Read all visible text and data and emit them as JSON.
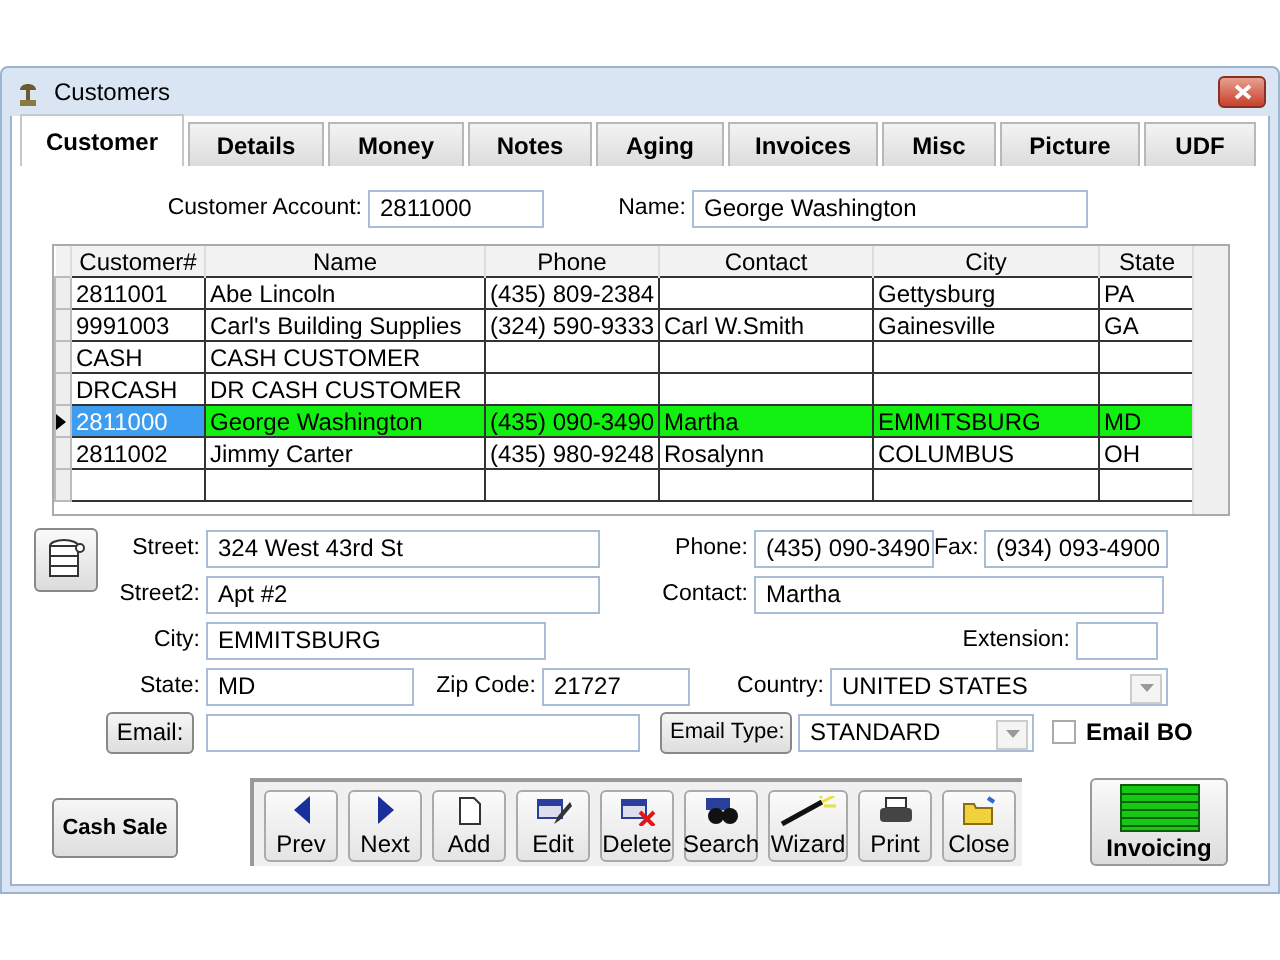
{
  "window": {
    "title": "Customers"
  },
  "tabs": [
    {
      "label": "Customer",
      "selected": true
    },
    {
      "label": "Details",
      "selected": false
    },
    {
      "label": "Money",
      "selected": false
    },
    {
      "label": "Notes",
      "selected": false
    },
    {
      "label": "Aging",
      "selected": false
    },
    {
      "label": "Invoices",
      "selected": false
    },
    {
      "label": "Misc",
      "selected": false
    },
    {
      "label": "Picture",
      "selected": false
    },
    {
      "label": "UDF",
      "selected": false
    }
  ],
  "account": {
    "label": "Customer Account:",
    "value": "2811000"
  },
  "name": {
    "label": "Name:",
    "value": "George Washington"
  },
  "table": {
    "columns": [
      "Customer#",
      "Name",
      "Phone",
      "Contact",
      "City",
      "State"
    ],
    "rows": [
      {
        "cells": [
          "2811001",
          "Abe Lincoln",
          "(435) 809-2384",
          "",
          "Gettysburg",
          "PA"
        ],
        "selected": false
      },
      {
        "cells": [
          "9991003",
          "Carl's Building Supplies",
          "(324) 590-9333",
          "Carl W.Smith",
          "Gainesville",
          "GA"
        ],
        "selected": false
      },
      {
        "cells": [
          "CASH",
          "CASH CUSTOMER",
          "",
          "",
          "",
          ""
        ],
        "selected": false
      },
      {
        "cells": [
          "DRCASH",
          "DR CASH CUSTOMER",
          "",
          "",
          "",
          ""
        ],
        "selected": false
      },
      {
        "cells": [
          "2811000",
          "George Washington",
          "(435) 090-3490",
          "Martha",
          "EMMITSBURG",
          "MD"
        ],
        "selected": true
      },
      {
        "cells": [
          "2811002",
          "Jimmy Carter",
          "(435) 980-9248",
          "Rosalynn",
          "COLUMBUS",
          "OH"
        ],
        "selected": false
      }
    ]
  },
  "street": {
    "label": "Street:",
    "value": "324 West 43rd St"
  },
  "street2": {
    "label": "Street2:",
    "value": "Apt #2"
  },
  "city": {
    "label": "City:",
    "value": "EMMITSBURG"
  },
  "state": {
    "label": "State:",
    "value": "MD"
  },
  "zip": {
    "label": "Zip Code:",
    "value": "21727"
  },
  "phone": {
    "label": "Phone:",
    "value": "(435) 090-3490"
  },
  "fax": {
    "label": "Fax:",
    "value": "(934) 093-4900"
  },
  "contact": {
    "label": "Contact:",
    "value": "Martha"
  },
  "extension": {
    "label": "Extension:"
  },
  "country": {
    "label": "Country:",
    "value": "UNITED STATES"
  },
  "email": {
    "label": "Email:"
  },
  "email_type": {
    "label": "Email Type:",
    "value": "STANDARD"
  },
  "email_bo": {
    "label": "Email BO",
    "checked": false
  },
  "cash_sale": {
    "label": "Cash Sale"
  },
  "toolbar": [
    {
      "label": "Prev"
    },
    {
      "label": "Next"
    },
    {
      "label": "Add"
    },
    {
      "label": "Edit"
    },
    {
      "label": "Delete"
    },
    {
      "label": "Search"
    },
    {
      "label": "Wizard"
    },
    {
      "label": "Print"
    },
    {
      "label": "Close"
    }
  ],
  "invoicing": {
    "label": "Invoicing"
  }
}
